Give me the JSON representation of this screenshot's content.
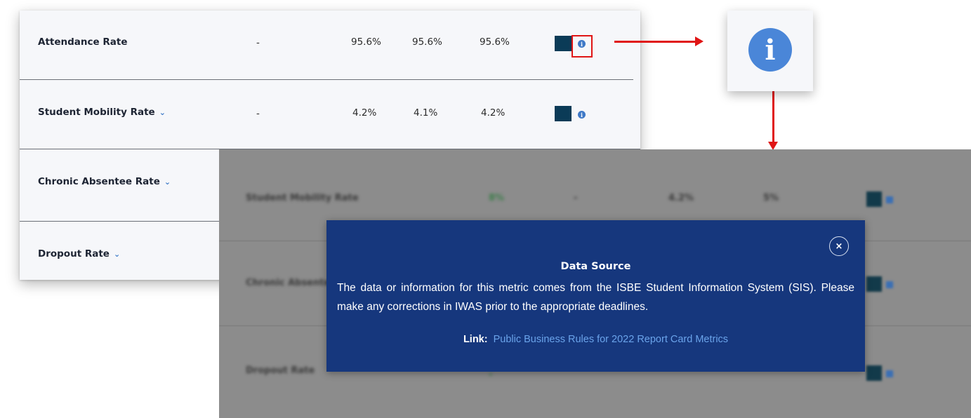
{
  "table": {
    "rows": [
      {
        "label": "Attendance Rate",
        "dash": "-",
        "v1": "95.6%",
        "v2": "95.6%",
        "v3": "95.6%",
        "has_chevron": false
      },
      {
        "label": "Student Mobility Rate",
        "dash": "-",
        "v1": "4.2%",
        "v2": "4.1%",
        "v3": "4.2%",
        "has_chevron": true
      },
      {
        "label": "Chronic Absentee Rate",
        "has_chevron": true
      },
      {
        "label": "Dropout Rate",
        "has_chevron": true
      }
    ],
    "chevron": "⌄",
    "info_glyph": "i",
    "legend_color": "#0b3b57"
  },
  "zoom": {
    "info_glyph": "i",
    "icon_color": "#4a86d8"
  },
  "overlay_bg": {
    "rows": [
      {
        "label": "Student Mobility Rate",
        "v0": "8%",
        "dash": "-",
        "v1": "4.2%",
        "v2": "5%"
      },
      {
        "label": "Chronic Absentee Rate"
      },
      {
        "label": "Dropout Rate",
        "v0": "-"
      }
    ]
  },
  "modal": {
    "close_glyph": "×",
    "title": "Data Source",
    "body": "The data or information for this metric comes from the ISBE Student Information System (SIS). Please make any corrections in IWAS prior to the appropriate deadlines.",
    "link_label": "Link:",
    "link_text": "Public Business Rules for 2022 Report Card Metrics",
    "bg_color": "#16377d",
    "link_color": "#6aa3ea"
  },
  "annotation_color": "#e01515"
}
